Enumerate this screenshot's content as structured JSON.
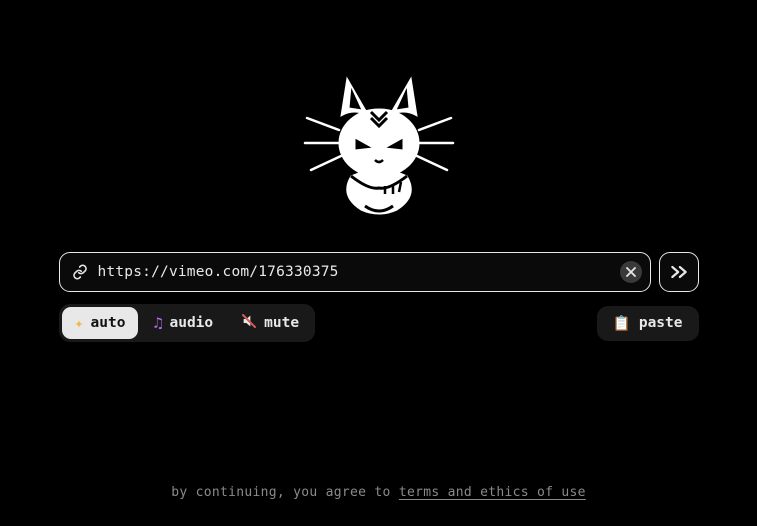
{
  "logo": {
    "name": "cat-mascot-logo"
  },
  "input": {
    "value": "https://vimeo.com/176330375",
    "placeholder": ""
  },
  "modes": {
    "auto": "auto",
    "audio": "audio",
    "mute": "mute",
    "active": "auto"
  },
  "paste": {
    "label": "paste"
  },
  "footer": {
    "prefix": "by continuing, you agree to ",
    "link_text": "terms and ethics of use"
  },
  "icons": {
    "link": "link-icon",
    "clear": "close-icon",
    "go": "chevron-double-right-icon",
    "sparkle": "sparkle-icon",
    "music": "music-notes-icon",
    "mute": "speaker-mute-icon",
    "clipboard": "clipboard-icon"
  }
}
